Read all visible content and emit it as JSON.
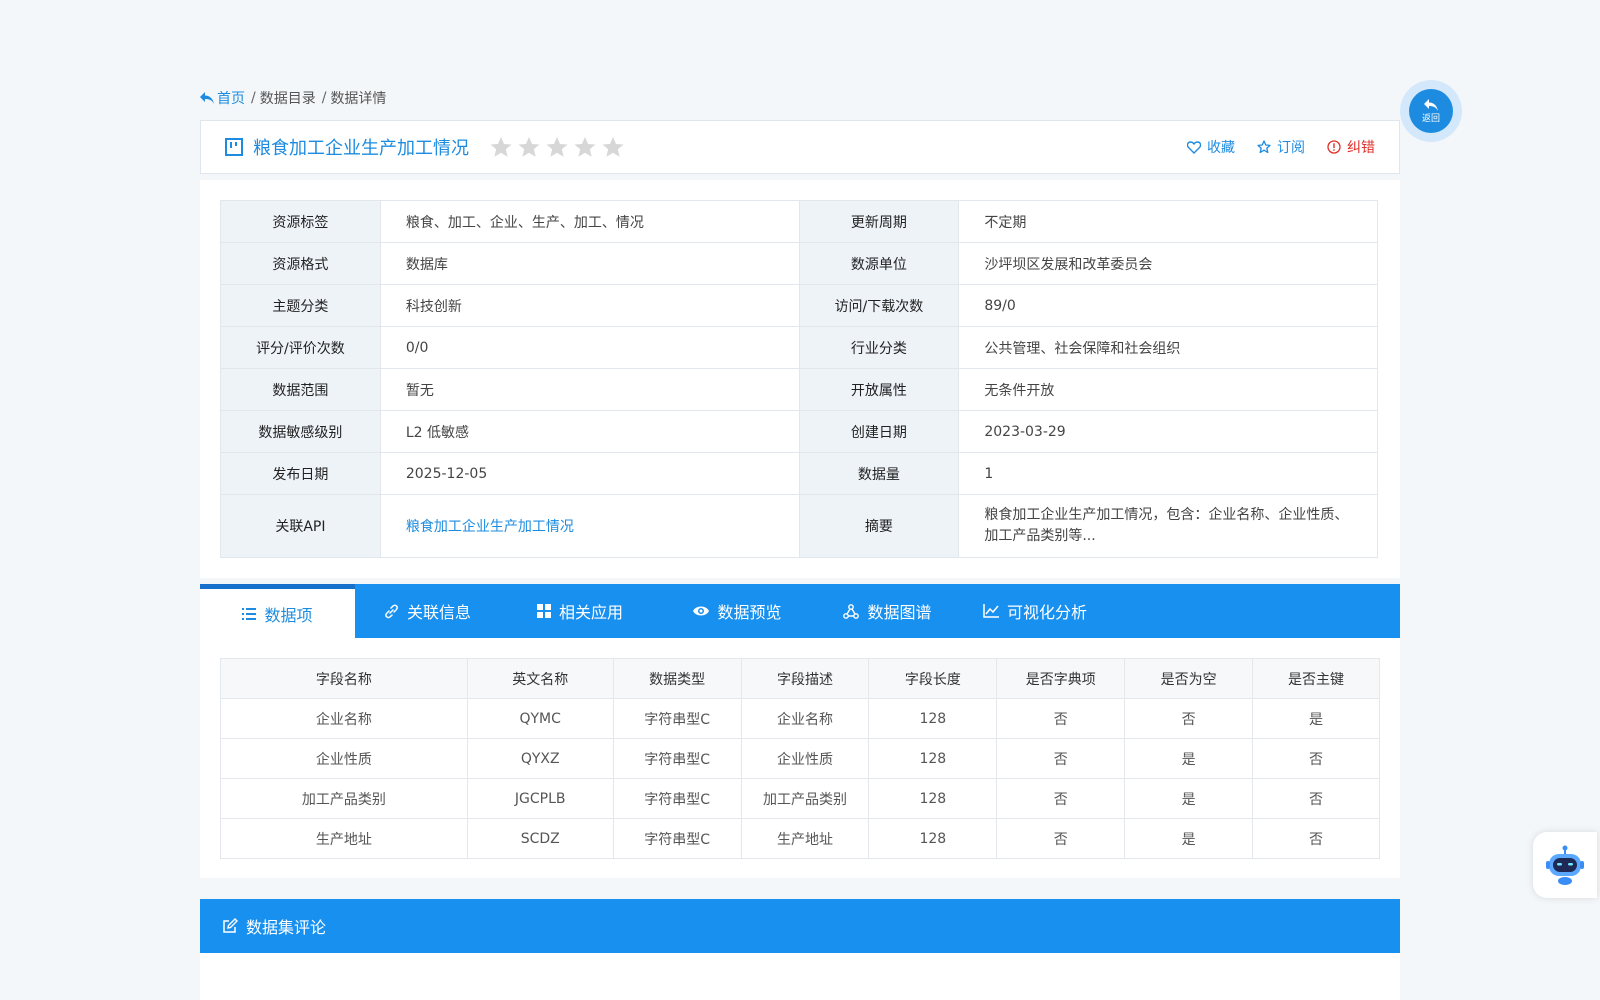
{
  "breadcrumb": {
    "home": "首页",
    "sep1": "/",
    "catalog": "数据目录",
    "sep2": "/",
    "detail": "数据详情"
  },
  "title": "粮食加工企业生产加工情况",
  "rating": {
    "filled": 0,
    "total": 5
  },
  "actions": {
    "collect": "收藏",
    "subscribe": "订阅",
    "report": "纠错"
  },
  "info": {
    "rows": [
      {
        "k1": "资源标签",
        "v1": "粮食、加工、企业、生产、加工、情况",
        "k2": "更新周期",
        "v2": "不定期"
      },
      {
        "k1": "资源格式",
        "v1": "数据库",
        "k2": "数源单位",
        "v2": "沙坪坝区发展和改革委员会"
      },
      {
        "k1": "主题分类",
        "v1": "科技创新",
        "k2": "访问/下载次数",
        "v2": "89/0"
      },
      {
        "k1": "评分/评价次数",
        "v1": "0/0",
        "k2": "行业分类",
        "v2": "公共管理、社会保障和社会组织"
      },
      {
        "k1": "数据范围",
        "v1": "暂无",
        "k2": "开放属性",
        "v2": "无条件开放"
      },
      {
        "k1": "数据敏感级别",
        "v1": "L2 低敏感",
        "k2": "创建日期",
        "v2": "2023-03-29"
      },
      {
        "k1": "发布日期",
        "v1": "2025-12-05",
        "k2": "数据量",
        "v2": "1"
      }
    ],
    "api": {
      "k1": "关联API",
      "v1": "粮食加工企业生产加工情况",
      "k2": "摘要",
      "v2_line1": "粮食加工企业生产加工情况，包含：企业名称、企业性质、",
      "v2_line2": "加工产品类别等..."
    }
  },
  "tabs": [
    {
      "label": "数据项",
      "icon": "list-icon"
    },
    {
      "label": "关联信息",
      "icon": "link-icon"
    },
    {
      "label": "相关应用",
      "icon": "grid-icon"
    },
    {
      "label": "数据预览",
      "icon": "eye-icon"
    },
    {
      "label": "数据图谱",
      "icon": "graph-icon"
    },
    {
      "label": "可视化分析",
      "icon": "chart-icon"
    }
  ],
  "fields": {
    "headers": [
      "字段名称",
      "英文名称",
      "数据类型",
      "字段描述",
      "字段长度",
      "是否字典项",
      "是否为空",
      "是否主键"
    ],
    "rows": [
      [
        "企业名称",
        "QYMC",
        "字符串型C",
        "企业名称",
        "128",
        "否",
        "否",
        "是"
      ],
      [
        "企业性质",
        "QYXZ",
        "字符串型C",
        "企业性质",
        "128",
        "否",
        "是",
        "否"
      ],
      [
        "加工产品类别",
        "JGCPLB",
        "字符串型C",
        "加工产品类别",
        "128",
        "否",
        "是",
        "否"
      ],
      [
        "生产地址",
        "SCDZ",
        "字符串型C",
        "生产地址",
        "128",
        "否",
        "是",
        "否"
      ]
    ]
  },
  "comment": {
    "title": "数据集评论"
  },
  "back": {
    "label": "返回"
  },
  "colors": {
    "primary": "#1890f0",
    "link": "#1d8ce0",
    "error": "#e0302a"
  }
}
